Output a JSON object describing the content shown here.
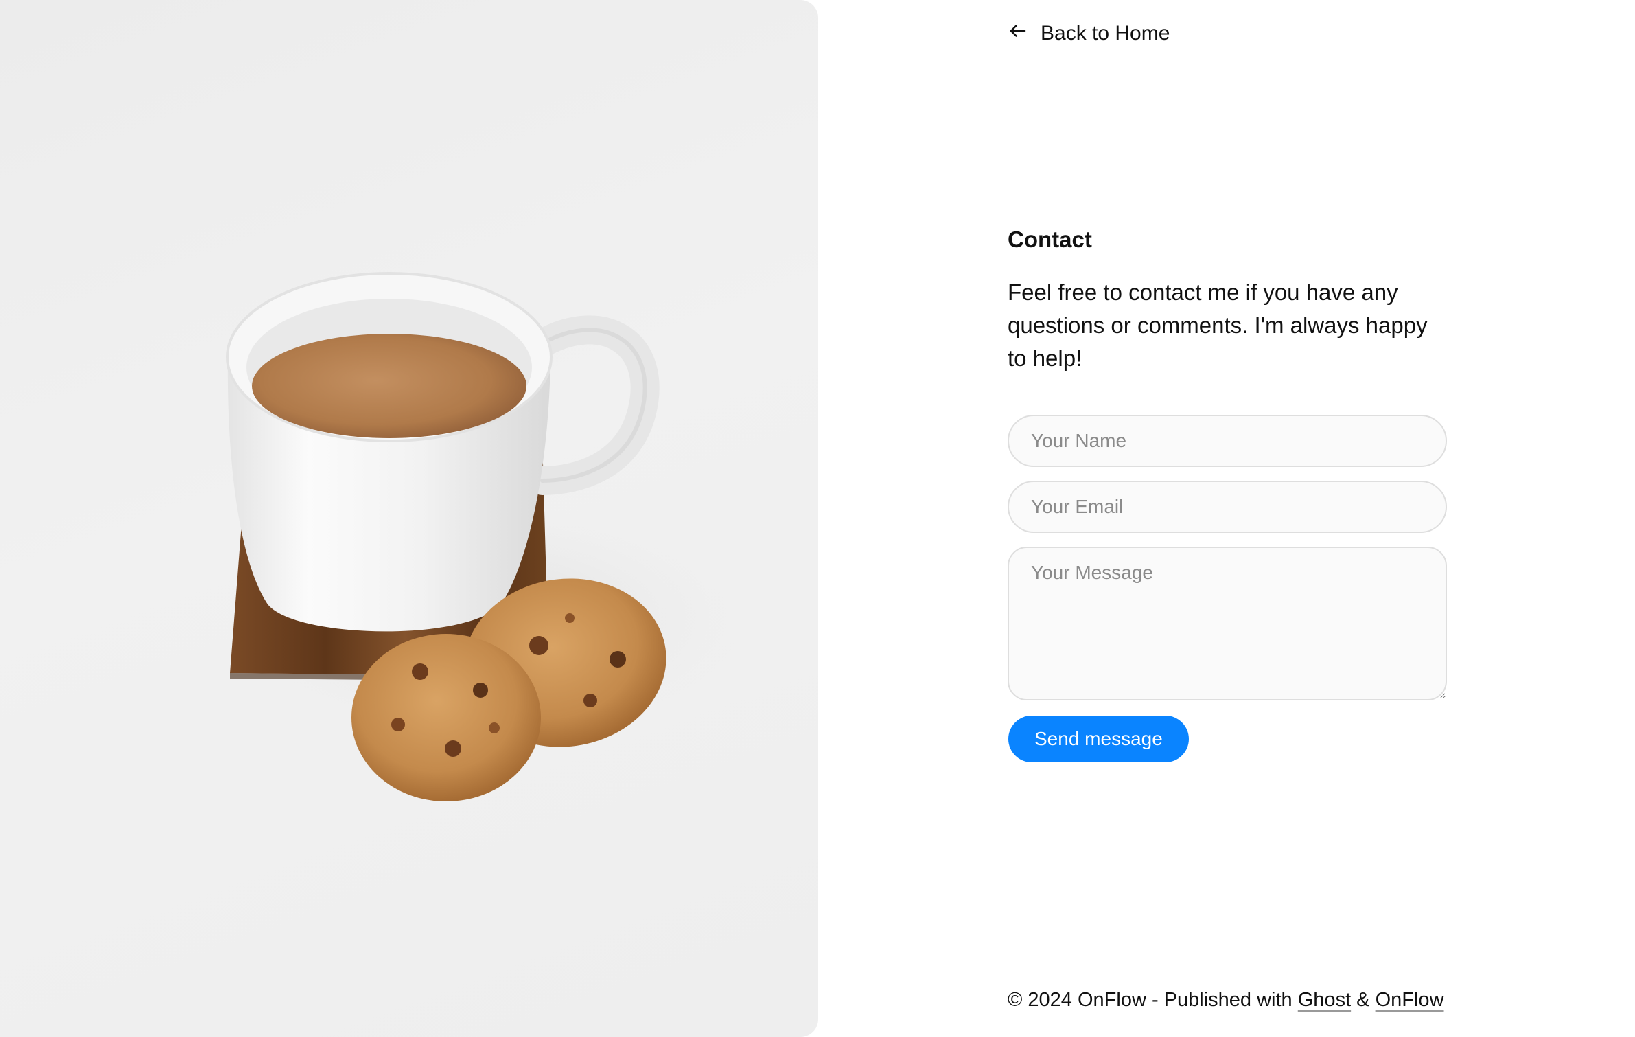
{
  "hero": {
    "image_alt": "Cup of coffee with cookies on a wooden coaster"
  },
  "nav": {
    "back_label": "Back to Home",
    "back_icon": "arrow-left-icon"
  },
  "contact": {
    "title": "Contact",
    "description": "Feel free to contact me if you have any questions or comments. I'm always happy to help!",
    "form": {
      "name_placeholder": "Your Name",
      "email_placeholder": "Your Email",
      "message_placeholder": "Your Message",
      "submit_label": "Send message"
    }
  },
  "footer": {
    "prefix": "© 2024 OnFlow - Published with ",
    "link_ghost": "Ghost",
    "separator": " & ",
    "link_onflow": "OnFlow"
  },
  "colors": {
    "accent": "#0a84ff",
    "text": "#111111",
    "field_bg": "#fafafa",
    "field_border": "#dedede"
  }
}
